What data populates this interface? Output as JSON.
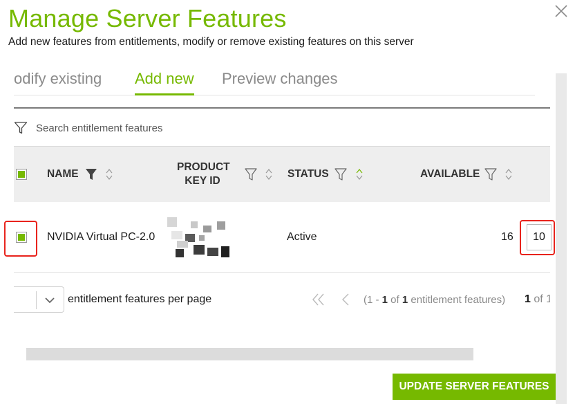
{
  "dialog": {
    "title": "Manage Server Features",
    "subtitle": "Add new features from entitlements, modify or remove existing features on this server"
  },
  "tabs": [
    {
      "label": "odify existing",
      "active": false
    },
    {
      "label": "Add new",
      "active": true
    },
    {
      "label": "Preview changes",
      "active": false
    }
  ],
  "search": {
    "placeholder": "Search entitlement features",
    "value": ""
  },
  "table": {
    "columns": [
      {
        "label": "NAME",
        "filter_icon": "filled-funnel-icon",
        "sort_icon": "sort-icon"
      },
      {
        "label_line1": "PRODUCT",
        "label_line2": "KEY ID",
        "filter_icon": "funnel-icon",
        "sort_icon": "sort-icon"
      },
      {
        "label": "STATUS",
        "filter_icon": "funnel-icon",
        "sort_icon": "sort-icon"
      },
      {
        "label": "AVAILABLE",
        "filter_icon": "funnel-icon",
        "sort_icon": "sort-icon"
      }
    ],
    "rows": [
      {
        "selected": true,
        "name": "NVIDIA Virtual PC-2.0",
        "product_key_id": "",
        "status": "Active",
        "available": "16",
        "quantity": "10"
      }
    ]
  },
  "pagination": {
    "per_page_label": "entitlement features per page",
    "per_page_value": "",
    "info_prefix": "(1 - ",
    "info_to": "1",
    "info_mid": " of ",
    "info_total": "1",
    "info_suffix": " entitlement features)",
    "page_current": "1",
    "page_of": " of 1"
  },
  "actions": {
    "update_label": "UPDATE SERVER FEATURES"
  },
  "colors": {
    "accent": "#76b900",
    "highlight": "#e8231c"
  }
}
